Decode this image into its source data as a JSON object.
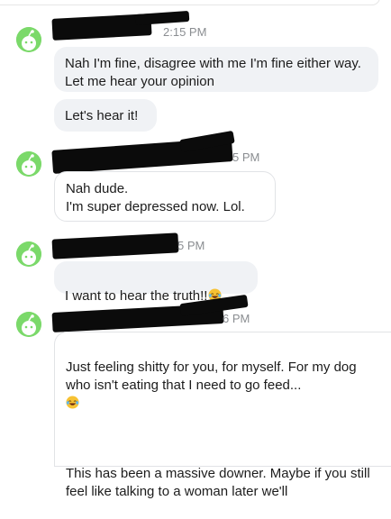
{
  "messages": [
    {
      "time": "2:15 PM",
      "bubbles": [
        "Nah I'm fine, disagree with me I'm fine either way. Let me hear your opinion",
        "Let's hear it!"
      ]
    },
    {
      "time": "5 PM",
      "bubbles": [
        "Nah dude.\nI'm super depressed now. Lol."
      ]
    },
    {
      "time": "5 PM",
      "bubbles": [
        "I want to hear the truth!!"
      ],
      "emoji": "laughing-emoji"
    },
    {
      "time": "6 PM",
      "bubbles": [
        "Just feeling shitty for you, for myself. For my dog who isn't eating that I need to go feed...",
        "This has been a massive downer. Maybe if you still feel like talking to a woman later we'll"
      ],
      "emoji": "laughing-emoji"
    }
  ],
  "colors": {
    "avatar_green": "#7bd96a",
    "bubble_gray": "#f0f2f5",
    "timestamp": "#8a8d91"
  }
}
